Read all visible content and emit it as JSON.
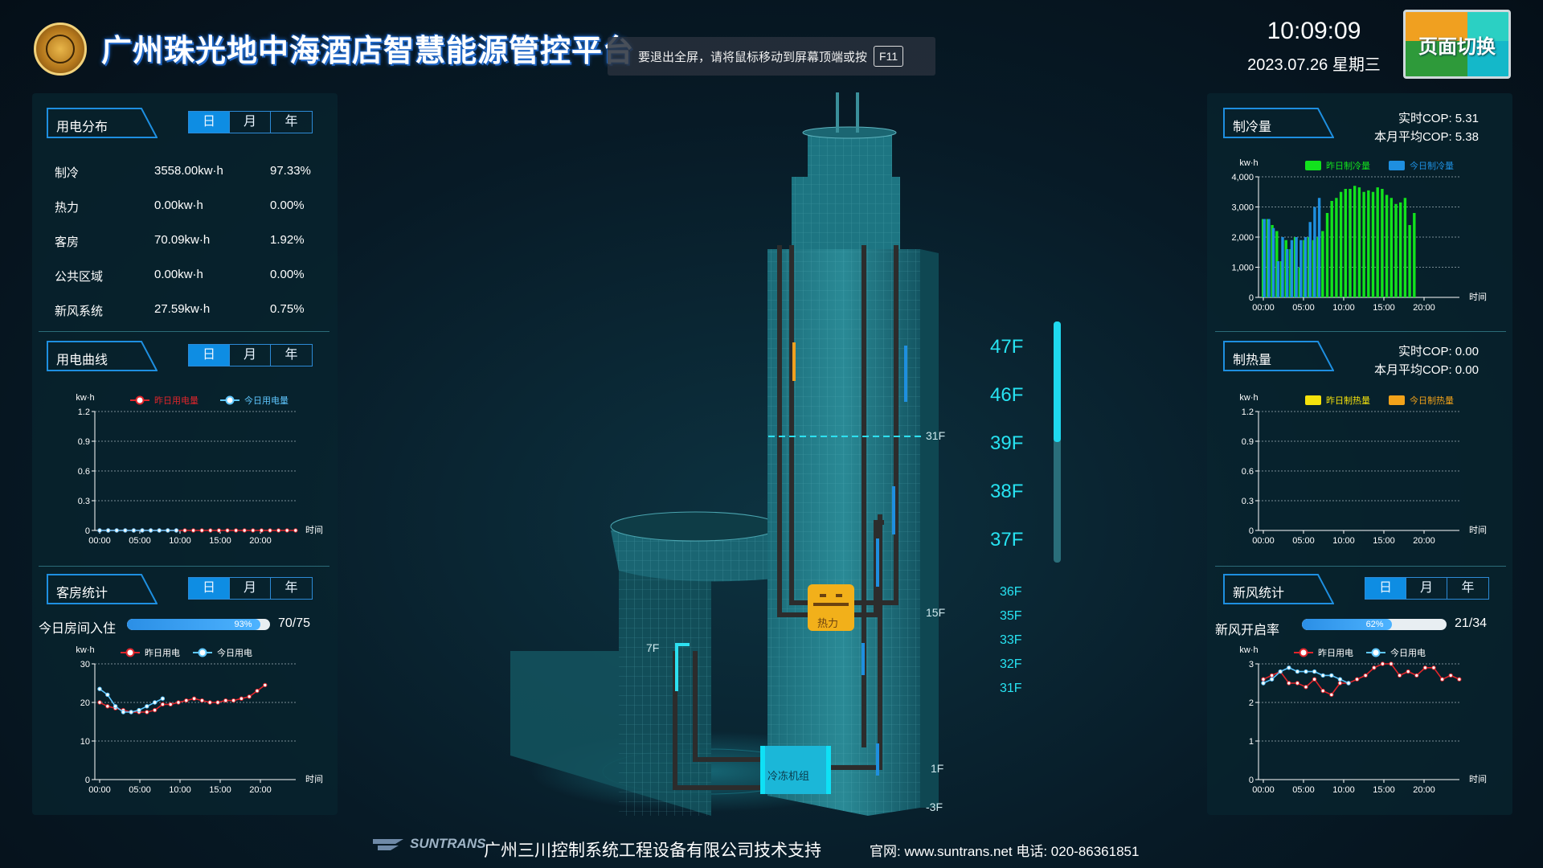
{
  "header": {
    "title": "广州珠光地中海酒店智慧能源管控平台",
    "fullscreen_tip": "要退出全屏，请将鼠标移动到屏幕顶端或按",
    "fullscreen_key": "F11",
    "time": "10:09:09",
    "date": "2023.07.26 星期三",
    "switch_label": "页面切换"
  },
  "tabs": {
    "day": "日",
    "month": "月",
    "year": "年"
  },
  "power_distribution": {
    "title": "用电分布",
    "rows": [
      {
        "name": "制冷",
        "value": "3558.00kw·h",
        "percent": "97.33%"
      },
      {
        "name": "热力",
        "value": "0.00kw·h",
        "percent": "0.00%"
      },
      {
        "name": "客房",
        "value": "70.09kw·h",
        "percent": "1.92%"
      },
      {
        "name": "公共区域",
        "value": "0.00kw·h",
        "percent": "0.00%"
      },
      {
        "name": "新风系统",
        "value": "27.59kw·h",
        "percent": "0.75%"
      }
    ]
  },
  "power_curve": {
    "title": "用电曲线"
  },
  "room_stats": {
    "title": "客房统计",
    "occupancy_label": "今日房间入住",
    "occupancy_percent_text": "93%",
    "occupancy_fraction": 0.93,
    "occupancy_ratio": "70/75"
  },
  "cooling": {
    "title": "制冷量",
    "cop_realtime_label": "实时COP:",
    "cop_realtime": "5.31",
    "cop_month_label": "本月平均COP:",
    "cop_month": "5.38"
  },
  "heating": {
    "title": "制热量",
    "cop_realtime_label": "实时COP:",
    "cop_realtime": "0.00",
    "cop_month_label": "本月平均COP:",
    "cop_month": "0.00"
  },
  "fresh_air": {
    "title": "新风统计",
    "open_rate_label": "新风开启率",
    "open_rate_percent_text": "62%",
    "open_rate_fraction": 0.62,
    "open_ratio": "21/34"
  },
  "building": {
    "floors_big": [
      "47F",
      "46F",
      "39F",
      "38F",
      "37F"
    ],
    "floors_small": [
      "36F",
      "35F",
      "33F",
      "32F",
      "31F"
    ],
    "tag_31f": "31F",
    "tag_15f": "15F",
    "tag_7f": "7F",
    "tag_1f": "1F",
    "tag_b3f": "-3F",
    "heat_label": "热力",
    "chiller_label": "冷冻机组"
  },
  "footer": {
    "logo_text": "SUNTRANS",
    "support": "广州三川控制系统工程设备有限公司技术支持",
    "website": "官网: www.suntrans.net  电话: 020-86361851"
  },
  "colors": {
    "accent": "#0e8de3",
    "cyan": "#27e3f2",
    "yesterday_green": "#12e21d",
    "today_blue": "#1e8fe0",
    "yesterday_red": "#e0252b",
    "today_lightblue": "#5fc7ff",
    "heat_yellow": "#f5e20c",
    "heat_orange": "#f2a21a"
  },
  "chart_data": [
    {
      "id": "power-curve",
      "type": "line",
      "ylabel": "kw·h",
      "xlabel": "时间",
      "ylim": [
        0,
        1.2
      ],
      "yticks": [
        "0",
        "0.3",
        "0.6",
        "0.9",
        "1.2"
      ],
      "xticks": [
        "00:00",
        "05:00",
        "10:00",
        "15:00",
        "20:00"
      ],
      "series": [
        {
          "name": "昨日用电量",
          "color": "#e0252b",
          "values": [
            0,
            0,
            0,
            0,
            0,
            0,
            0,
            0,
            0,
            0,
            0,
            0,
            0,
            0,
            0,
            0,
            0,
            0,
            0,
            0,
            0,
            0,
            0,
            0
          ]
        },
        {
          "name": "今日用电量",
          "color": "#5fc7ff",
          "values": [
            0,
            0,
            0,
            0,
            0,
            0,
            0,
            0,
            0,
            0
          ]
        }
      ]
    },
    {
      "id": "room-curve",
      "type": "line",
      "ylabel": "kw·h",
      "xlabel": "时间",
      "ylim": [
        0,
        30
      ],
      "yticks": [
        "0",
        "10",
        "20",
        "30"
      ],
      "xticks": [
        "00:00",
        "05:00",
        "10:00",
        "15:00",
        "20:00"
      ],
      "series": [
        {
          "name": "昨日用电",
          "color": "#e0252b",
          "values": [
            20,
            19,
            18.5,
            18,
            17.5,
            17.5,
            17.5,
            18,
            19.5,
            19.5,
            20,
            20.5,
            21,
            20.5,
            20,
            20,
            20.5,
            20.5,
            21,
            21.5,
            23,
            24.5
          ]
        },
        {
          "name": "今日用电",
          "color": "#5fc7ff",
          "values": [
            23.5,
            22,
            19,
            17.5,
            17.5,
            18,
            19,
            20,
            21
          ]
        }
      ]
    },
    {
      "id": "cooling-bars",
      "type": "bar",
      "ylabel": "kw·h",
      "xlabel": "时间",
      "ylim": [
        0,
        4000
      ],
      "yticks": [
        "0",
        "1,000",
        "2,000",
        "3,000",
        "4,000"
      ],
      "xticks": [
        "00:00",
        "05:00",
        "10:00",
        "15:00",
        "20:00"
      ],
      "series": [
        {
          "name": "昨日制冷量",
          "color": "#12e21d",
          "values": [
            2600,
            2600,
            2400,
            2200,
            1200,
            1900,
            1600,
            2000,
            1000,
            1900,
            2000,
            1900,
            2000,
            2200,
            2800,
            3200,
            3300,
            3500,
            3600,
            3600,
            3700,
            3650,
            3500,
            3550,
            3500,
            3650,
            3600,
            3400,
            3300,
            3100,
            3150,
            3300,
            2400,
            2800
          ]
        },
        {
          "name": "今日制冷量",
          "color": "#1e8fe0",
          "values": [
            2600,
            2600,
            2300,
            1200,
            2000,
            1600,
            1900,
            2000,
            1900,
            2000,
            2500,
            3000,
            3300
          ]
        }
      ]
    },
    {
      "id": "heating-bars",
      "type": "bar",
      "ylabel": "kw·h",
      "xlabel": "时间",
      "ylim": [
        0,
        1.2
      ],
      "yticks": [
        "0",
        "0.3",
        "0.6",
        "0.9",
        "1.2"
      ],
      "xticks": [
        "00:00",
        "05:00",
        "10:00",
        "15:00",
        "20:00"
      ],
      "series": [
        {
          "name": "昨日制热量",
          "color": "#f5e20c",
          "values": []
        },
        {
          "name": "今日制热量",
          "color": "#f2a21a",
          "values": []
        }
      ]
    },
    {
      "id": "fresh-air-curve",
      "type": "line",
      "ylabel": "kw·h",
      "xlabel": "时间",
      "ylim": [
        0,
        3
      ],
      "yticks": [
        "0",
        "1",
        "2",
        "3"
      ],
      "xticks": [
        "00:00",
        "05:00",
        "10:00",
        "15:00",
        "20:00"
      ],
      "series": [
        {
          "name": "昨日用电",
          "color": "#e0252b",
          "values": [
            2.6,
            2.7,
            2.8,
            2.5,
            2.5,
            2.4,
            2.6,
            2.3,
            2.2,
            2.5,
            2.5,
            2.6,
            2.7,
            2.9,
            3.0,
            3.0,
            2.7,
            2.8,
            2.7,
            2.9,
            2.9,
            2.6,
            2.7,
            2.6
          ]
        },
        {
          "name": "今日用电",
          "color": "#5fc7ff",
          "values": [
            2.5,
            2.6,
            2.8,
            2.9,
            2.8,
            2.8,
            2.8,
            2.7,
            2.7,
            2.6,
            2.5
          ]
        }
      ]
    }
  ]
}
